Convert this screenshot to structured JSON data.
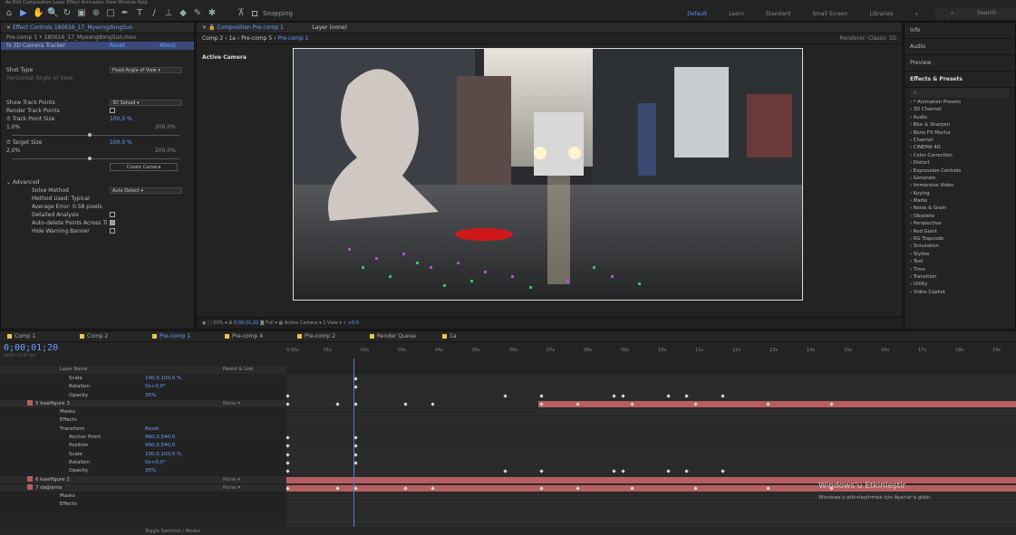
{
  "menubar": "Ae  Edit  Composition  Layer  Effect  Animation  View  Window  Help",
  "toolbar": {
    "snapping_label": "Snapping",
    "workspaces": [
      "Default",
      "Learn",
      "Standard",
      "Small Screen",
      "Libraries"
    ],
    "active_workspace": "Default",
    "search_placeholder": "Search Help"
  },
  "effect_controls": {
    "tab_title": "Effect Controls 180616_17_MyeongdongSun",
    "breadcrumb": "Pre-comp 1 • 180616_17_MyeongdongSun.mov",
    "effect_name": "3D Camera Tracker",
    "reset": "Reset",
    "about": "About",
    "shot_type_label": "Shot Type",
    "shot_type_value": "Fixed Angle of View",
    "hfov_label": "Horizontal Angle of View",
    "show_track_points_label": "Show Track Points",
    "show_track_points_value": "3D Solved",
    "render_track_points_label": "Render Track Points",
    "track_point_size_label": "Track Point Size",
    "track_point_size_value": "100,0 %",
    "tp_min": "1,0%",
    "tp_max": "200,0%",
    "target_size_label": "Target Size",
    "target_size_value": "100,0 %",
    "ts_min": "2,0%",
    "ts_max": "200,0%",
    "create_camera": "Create Camera",
    "advanced_label": "Advanced",
    "solve_method_label": "Solve Method",
    "solve_method_value": "Auto Detect",
    "method_used": "Method Used: Typical",
    "avg_error": "Average Error: 0.58 pixels",
    "detailed_analysis": "Detailed Analysis",
    "auto_delete": "Auto-delete Points Across Ti",
    "hide_warning": "Hide Warning Banner"
  },
  "composition": {
    "tab_title": "Composition Pre-comp 1",
    "layer_tab": "Layer (none)",
    "breadcrumb": [
      "Comp 2",
      "1a",
      "Pre-comp 5",
      "Pre-comp 1"
    ],
    "renderer_label": "Renderer:",
    "renderer_value": "Classic 3D",
    "active_camera_label": "Active Camera",
    "zoom": "50%",
    "timecode": "0;00;01;20",
    "resolution": "Full",
    "camera_select": "Active Camera",
    "view_select": "1 View",
    "offset": "+0,0"
  },
  "right_panel": {
    "info": "Info",
    "audio": "Audio",
    "preview": "Preview",
    "effects_title": "Effects & Presets",
    "effects": [
      "* Animation Presets",
      "3D Channel",
      "Audio",
      "Blur & Sharpen",
      "Boris FX Mocha",
      "Channel",
      "CINEMA 4D",
      "Color Correction",
      "Distort",
      "Expression Controls",
      "Generate",
      "Immersive Video",
      "Keying",
      "Matte",
      "Noise & Grain",
      "Obsolete",
      "Perspective",
      "Red Giant",
      "RG Trapcode",
      "Simulation",
      "Stylize",
      "Text",
      "Time",
      "Transition",
      "Utility",
      "Video Copilot"
    ]
  },
  "timeline": {
    "tabs": [
      "Comp 1",
      "Comp 2",
      "Pre-comp 1",
      "Pre-comp 4",
      "Pre-comp 2",
      "Render Queue",
      "1a"
    ],
    "active_tab": "Pre-comp 1",
    "timecode": "0;00;01;20",
    "fps": "00050 (29.97 fps)",
    "ruler": [
      "0:00s",
      "01s",
      "02s",
      "03s",
      "04s",
      "05s",
      "06s",
      "07s",
      "08s",
      "09s",
      "10s",
      "11s",
      "12s",
      "13s",
      "14s",
      "15s",
      "16s",
      "17s",
      "18s",
      "19s"
    ],
    "column_header": "Layer Name",
    "parent_header": "Parent & Link",
    "layers": [
      {
        "indent": 76,
        "name": "Scale",
        "value": "100,0,100,0 %",
        "kind": "prop"
      },
      {
        "indent": 76,
        "name": "Rotation",
        "value": "0x+0,0°",
        "kind": "prop"
      },
      {
        "indent": 76,
        "name": "Opacity",
        "value": "35%",
        "kind": "prop"
      },
      {
        "indent": 30,
        "name": "5  kaaifigure 3",
        "value": "",
        "parent": "None",
        "kind": "layer",
        "color": "#b85e60"
      },
      {
        "indent": 66,
        "name": "Masks",
        "value": "",
        "kind": "group"
      },
      {
        "indent": 66,
        "name": "Effects",
        "value": "",
        "kind": "group"
      },
      {
        "indent": 66,
        "name": "Transform",
        "value": "Reset",
        "kind": "group"
      },
      {
        "indent": 76,
        "name": "Anchor Point",
        "value": "960,0,540,0",
        "kind": "prop"
      },
      {
        "indent": 76,
        "name": "Position",
        "value": "960,0,540,0",
        "kind": "prop"
      },
      {
        "indent": 76,
        "name": "Scale",
        "value": "100,0,100,0 %",
        "kind": "prop"
      },
      {
        "indent": 76,
        "name": "Rotation",
        "value": "0x+0,0°",
        "kind": "prop"
      },
      {
        "indent": 76,
        "name": "Opacity",
        "value": "35%",
        "kind": "prop"
      },
      {
        "indent": 30,
        "name": "6  kaaifigure 2",
        "value": "",
        "parent": "None",
        "kind": "layer",
        "color": "#b85e60"
      },
      {
        "indent": 30,
        "name": "7  dağlama",
        "value": "",
        "parent": "None",
        "kind": "layer",
        "color": "#b85e60"
      },
      {
        "indent": 66,
        "name": "Masks",
        "value": "",
        "kind": "group"
      },
      {
        "indent": 66,
        "name": "Effects",
        "value": "",
        "kind": "group"
      }
    ],
    "toggle_label": "Toggle Switches / Modes"
  },
  "windows_activation": {
    "title": "Windows'u Etkinleştir",
    "subtitle": "Windows'u etkinleştirmek için Ayarlar'a gidin."
  }
}
